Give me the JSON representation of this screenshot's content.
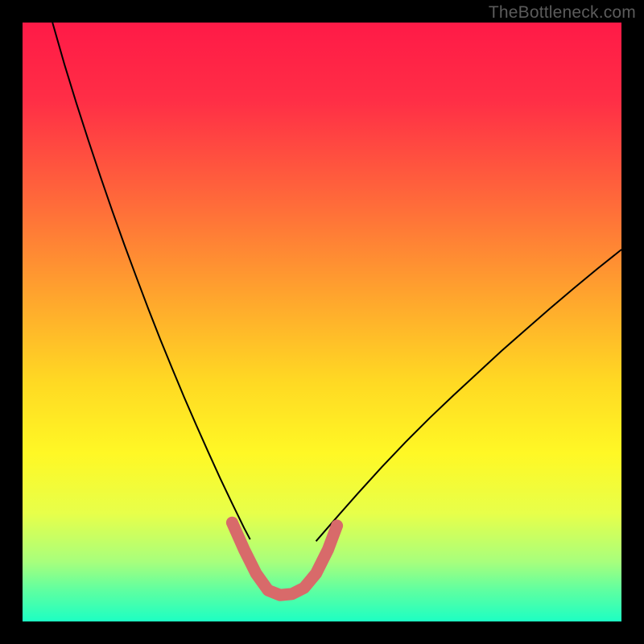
{
  "watermark": "TheBottleneck.com",
  "chart_data": {
    "type": "line",
    "title": "",
    "xlabel": "",
    "ylabel": "",
    "xlim": [
      0,
      100
    ],
    "ylim": [
      0,
      100
    ],
    "grid": false,
    "background_gradient": {
      "stops": [
        {
          "offset": 0.0,
          "color": "#ff1a47"
        },
        {
          "offset": 0.13,
          "color": "#ff2e46"
        },
        {
          "offset": 0.3,
          "color": "#ff6a3a"
        },
        {
          "offset": 0.45,
          "color": "#ffa22e"
        },
        {
          "offset": 0.6,
          "color": "#ffd923"
        },
        {
          "offset": 0.72,
          "color": "#fff825"
        },
        {
          "offset": 0.82,
          "color": "#e7ff4a"
        },
        {
          "offset": 0.9,
          "color": "#a8ff7c"
        },
        {
          "offset": 0.95,
          "color": "#5cffa2"
        },
        {
          "offset": 1.0,
          "color": "#1dffc3"
        }
      ]
    },
    "series": [
      {
        "name": "curve-left",
        "stroke": "#000000",
        "stroke_width": 2,
        "points": [
          {
            "x": 5.0,
            "y": 100.0
          },
          {
            "x": 7.0,
            "y": 93.0
          },
          {
            "x": 9.0,
            "y": 86.5
          },
          {
            "x": 11.0,
            "y": 80.3
          },
          {
            "x": 13.0,
            "y": 74.3
          },
          {
            "x": 15.0,
            "y": 68.5
          },
          {
            "x": 17.0,
            "y": 62.9
          },
          {
            "x": 19.0,
            "y": 57.5
          },
          {
            "x": 21.0,
            "y": 52.2
          },
          {
            "x": 23.0,
            "y": 47.1
          },
          {
            "x": 25.0,
            "y": 42.2
          },
          {
            "x": 27.0,
            "y": 37.4
          },
          {
            "x": 29.0,
            "y": 32.8
          },
          {
            "x": 31.0,
            "y": 28.3
          },
          {
            "x": 33.0,
            "y": 23.9
          },
          {
            "x": 35.0,
            "y": 19.7
          },
          {
            "x": 37.0,
            "y": 15.6
          },
          {
            "x": 38.0,
            "y": 13.7
          }
        ]
      },
      {
        "name": "curve-right",
        "stroke": "#000000",
        "stroke_width": 2,
        "points": [
          {
            "x": 49.0,
            "y": 13.4
          },
          {
            "x": 51.0,
            "y": 15.7
          },
          {
            "x": 53.0,
            "y": 18.0
          },
          {
            "x": 56.0,
            "y": 21.4
          },
          {
            "x": 60.0,
            "y": 25.8
          },
          {
            "x": 64.0,
            "y": 30.0
          },
          {
            "x": 68.0,
            "y": 34.0
          },
          {
            "x": 72.0,
            "y": 37.8
          },
          {
            "x": 76.0,
            "y": 41.5
          },
          {
            "x": 80.0,
            "y": 45.2
          },
          {
            "x": 84.0,
            "y": 48.7
          },
          {
            "x": 88.0,
            "y": 52.2
          },
          {
            "x": 92.0,
            "y": 55.6
          },
          {
            "x": 96.0,
            "y": 58.9
          },
          {
            "x": 100.0,
            "y": 62.1
          }
        ]
      },
      {
        "name": "highlight-band",
        "stroke": "#d86a6a",
        "stroke_width": 15,
        "linecap": "round",
        "points": [
          {
            "x": 35.0,
            "y": 16.5
          },
          {
            "x": 37.0,
            "y": 12.0
          },
          {
            "x": 39.0,
            "y": 8.0
          },
          {
            "x": 41.0,
            "y": 5.2
          },
          {
            "x": 43.0,
            "y": 4.4
          },
          {
            "x": 45.0,
            "y": 4.6
          },
          {
            "x": 47.0,
            "y": 5.6
          },
          {
            "x": 49.0,
            "y": 8.0
          },
          {
            "x": 51.0,
            "y": 12.0
          },
          {
            "x": 52.5,
            "y": 16.0
          }
        ]
      }
    ]
  }
}
